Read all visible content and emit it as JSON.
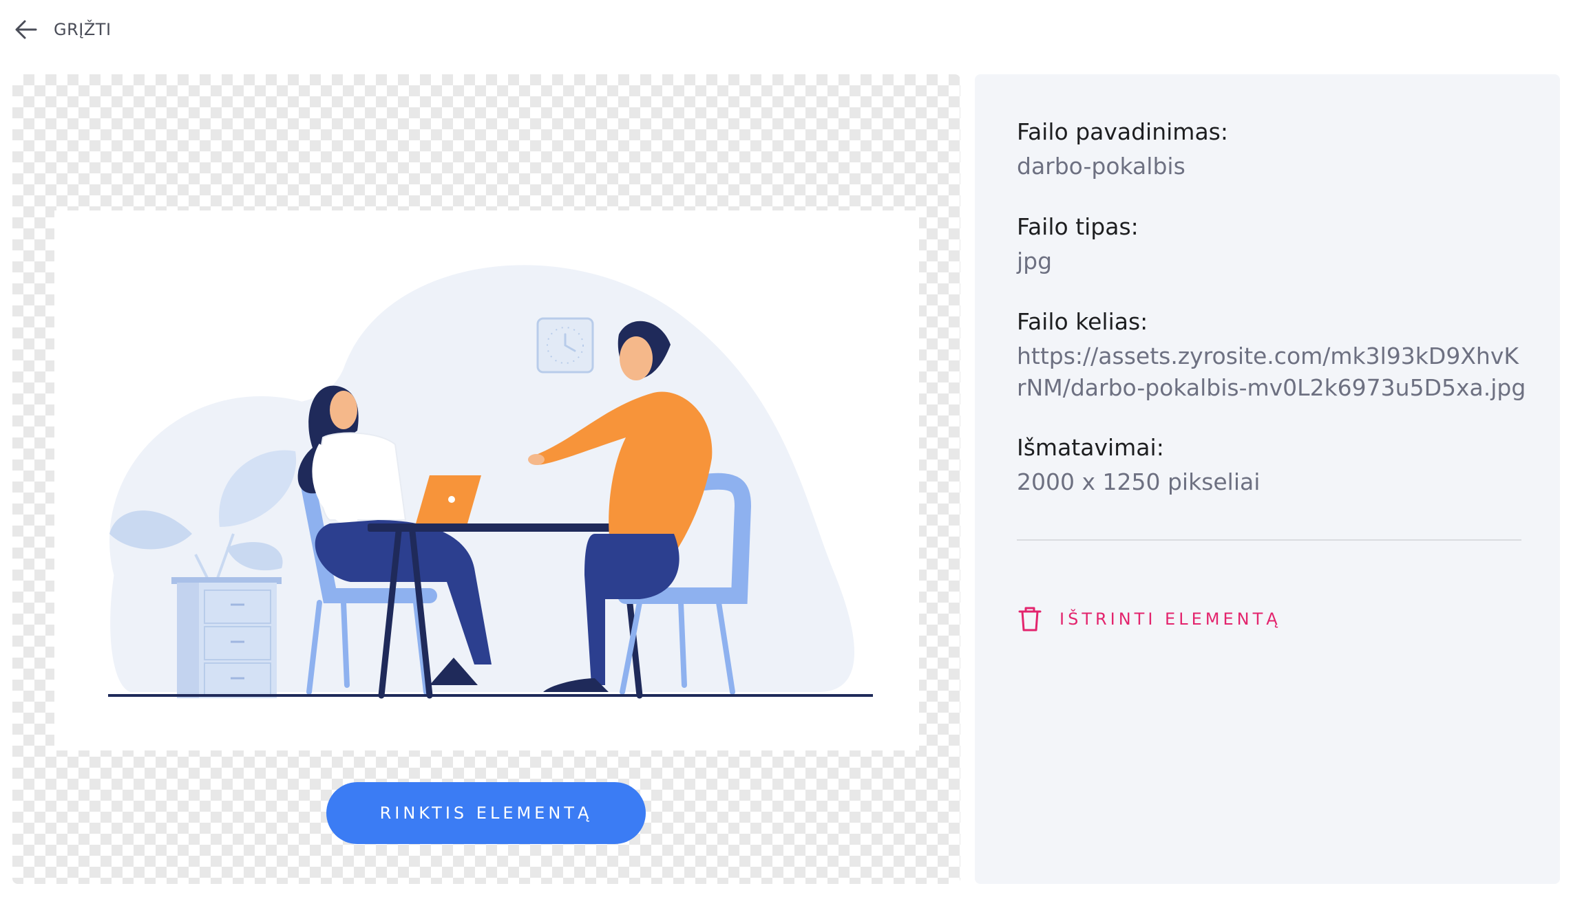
{
  "header": {
    "back_label": "GRĮŽTI",
    "back_icon": "arrow-left-icon"
  },
  "preview": {
    "select_label": "RINKTIS ELEMENTĄ",
    "accent_color": "#3b7cf4"
  },
  "info": {
    "fields": [
      {
        "label": "Failo pavadinimas:",
        "value": "darbo-pokalbis"
      },
      {
        "label": "Failo tipas:",
        "value": "jpg"
      },
      {
        "label": "Failo kelias:",
        "value": "https://assets.zyrosite.com/mk3l93kD9XhvKrNM/darbo-pokalbis-mv0L2k6973u5D5xa.jpg"
      },
      {
        "label": "Išmatavimai:",
        "value": "2000 x 1250 pikseliai"
      }
    ],
    "delete_label": "IŠTRINTI ELEMENTĄ",
    "delete_icon": "trash-icon",
    "delete_color": "#e3246d"
  }
}
